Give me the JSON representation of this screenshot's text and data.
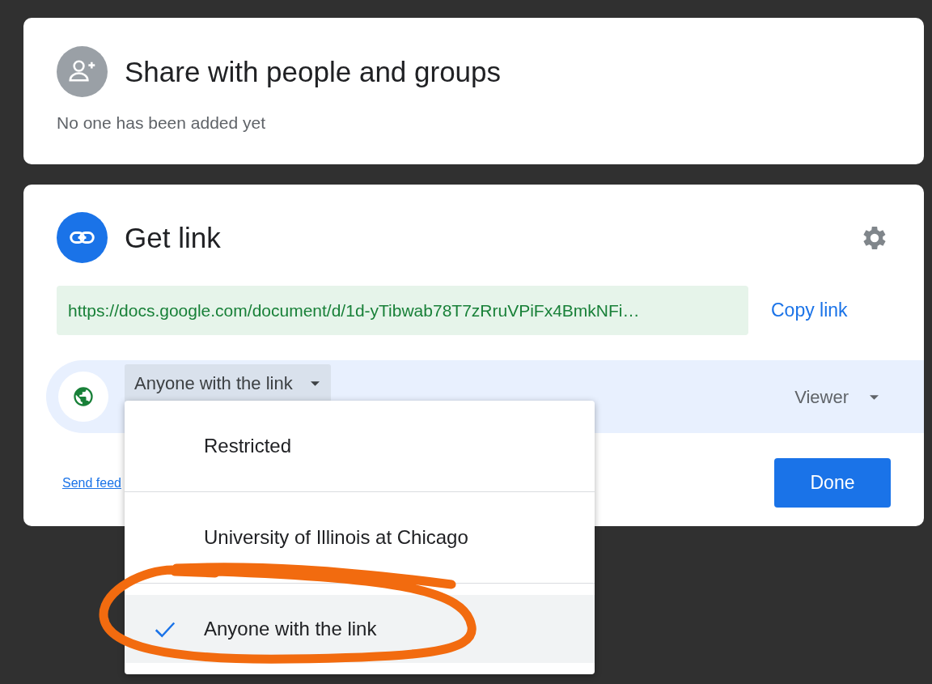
{
  "share": {
    "title": "Share with people and groups",
    "note": "No one has been added yet"
  },
  "get_link": {
    "title": "Get link",
    "url": "https://docs.google.com/document/d/1d-yTibwab78T7zRruVPiFx4BmkNFi…",
    "copy_label": "Copy link",
    "access": {
      "label": "Anyone with the link",
      "expanded": true
    },
    "role": {
      "label": "Viewer"
    },
    "feedback_link": "Send feed",
    "done_label": "Done"
  },
  "access_menu": {
    "options": [
      {
        "label": "Restricted",
        "selected": false
      },
      {
        "label": "University of Illinois at Chicago",
        "selected": false
      },
      {
        "label": "Anyone with the link",
        "selected": true
      }
    ]
  }
}
